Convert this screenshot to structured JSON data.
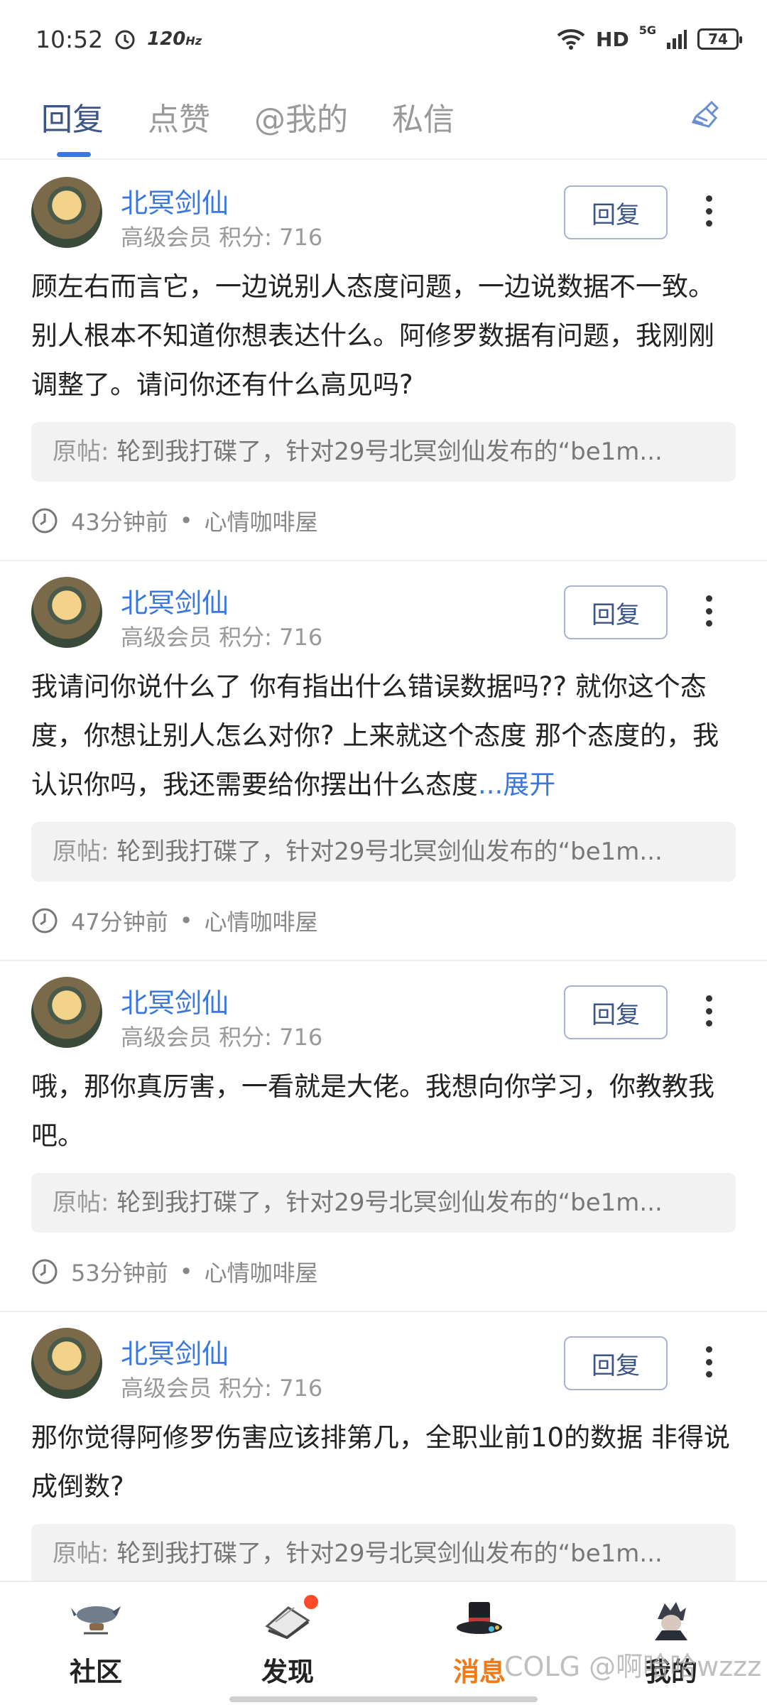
{
  "status_bar": {
    "time": "10:52",
    "refresh": "120",
    "refresh_unit": "Hz",
    "network": "HD",
    "network_gen": "5G",
    "battery": "74"
  },
  "tabs": [
    {
      "label": "回复",
      "active": true
    },
    {
      "label": "点赞",
      "active": false
    },
    {
      "label": "@我的",
      "active": false
    },
    {
      "label": "私信",
      "active": false
    }
  ],
  "clear_icon": "broom-icon",
  "cards": [
    {
      "username": "北冥剑仙",
      "level": "高级会员 积分: 716",
      "reply_label": "回复",
      "content": "顾左右而言它，一边说别人态度问题，一边说数据不一致。别人根本不知道你想表达什么。阿修罗数据有问题，我刚刚调整了。请问你还有什么高见吗?",
      "expand": "",
      "quote_label": "原帖:",
      "quote_text": "轮到我打碟了，针对29号北冥剑仙发布的“be1m...",
      "time": "43分钟前",
      "dot": "•",
      "board": "心情咖啡屋"
    },
    {
      "username": "北冥剑仙",
      "level": "高级会员 积分: 716",
      "reply_label": "回复",
      "content": "我请问你说什么了 你有指出什么错误数据吗?? 就你这个态度，你想让别人怎么对你? 上来就这个态度 那个态度的，我认识你吗，我还需要给你摆出什么态度",
      "expand": "...展开",
      "quote_label": "原帖:",
      "quote_text": "轮到我打碟了，针对29号北冥剑仙发布的“be1m...",
      "time": "47分钟前",
      "dot": "•",
      "board": "心情咖啡屋"
    },
    {
      "username": "北冥剑仙",
      "level": "高级会员 积分: 716",
      "reply_label": "回复",
      "content": "哦，那你真厉害，一看就是大佬。我想向你学习，你教教我吧。",
      "expand": "",
      "quote_label": "原帖:",
      "quote_text": "轮到我打碟了，针对29号北冥剑仙发布的“be1m...",
      "time": "53分钟前",
      "dot": "•",
      "board": "心情咖啡屋"
    },
    {
      "username": "北冥剑仙",
      "level": "高级会员 积分: 716",
      "reply_label": "回复",
      "content": "那你觉得阿修罗伤害应该排第几，全职业前10的数据 非得说成倒数?",
      "expand": "",
      "quote_label": "原帖:",
      "quote_text": "轮到我打碟了，针对29号北冥剑仙发布的“be1m...",
      "time": "",
      "dot": "",
      "board": ""
    }
  ],
  "bottom_nav": [
    {
      "label": "社区",
      "icon": "airship-icon",
      "active": false
    },
    {
      "label": "发现",
      "icon": "discover-book-icon",
      "active": false,
      "badge": true
    },
    {
      "label": "消息",
      "icon": "top-hat-icon",
      "active": true
    },
    {
      "label": "我的",
      "icon": "profile-character-icon",
      "active": false
    }
  ],
  "watermark": "COLG @啊哈哈wzzz",
  "colors": {
    "accent_blue": "#3a78e0",
    "tab_active": "#3c5588",
    "nav_active": "#f07a18",
    "badge": "#ff4a2a"
  }
}
